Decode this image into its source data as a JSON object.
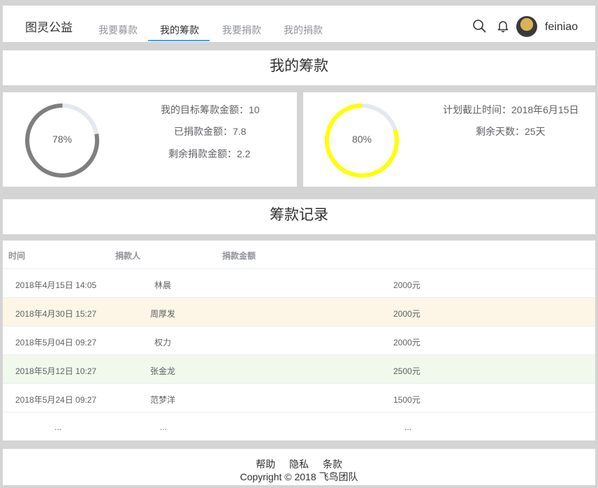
{
  "header": {
    "brand": "图灵公益",
    "tabs": [
      "我要募款",
      "我的筹款",
      "我要捐款",
      "我的捐款"
    ],
    "active_tab": 1,
    "username": "feiniao",
    "icons": [
      "search-icon",
      "bell-icon",
      "avatar"
    ]
  },
  "page_title": "我的筹款",
  "progress_card": {
    "percent_label": "78%",
    "percent_value": 0.78,
    "ring_color": "#7f7f7f",
    "target_line": "我的目标筹款金额：10",
    "raised_line": "已捐款金额：7.8",
    "remaining_line": "剩余捐款金额：2.2"
  },
  "time_card": {
    "percent_label": "80%",
    "percent_value": 0.8,
    "ring_color": "#ffff00",
    "deadline_line": "计划截止时间：2018年6月15日",
    "days_left_line": "剩余天数：25天"
  },
  "records_title": "筹款记录",
  "table": {
    "headers": [
      "时间",
      "捐款人",
      "捐款金额"
    ],
    "rows": [
      {
        "time": "2018年4月15日 14:05",
        "donor": "林晨",
        "amount": "2000元",
        "status": ""
      },
      {
        "time": "2018年4月30日 15:27",
        "donor": "周厚发",
        "amount": "2000元",
        "status": "warn"
      },
      {
        "time": "2018年5月04日 09:27",
        "donor": "权力",
        "amount": "2000元",
        "status": ""
      },
      {
        "time": "2018年5月12日 10:27",
        "donor": "张金龙",
        "amount": "2500元",
        "status": "ok"
      },
      {
        "time": "2018年5月24日 09:27",
        "donor": "范梦洋",
        "amount": "1500元",
        "status": ""
      },
      {
        "time": "...",
        "donor": "...",
        "amount": "...",
        "status": ""
      }
    ]
  },
  "footer": {
    "links": [
      "帮助",
      "隐私",
      "条款"
    ],
    "copyright": "Copyright © 2018 飞鸟团队"
  },
  "colors": {
    "accent": "#409eff",
    "ring_track": "#e4e8f1",
    "row_warning": "#fdf5e6",
    "row_success": "#f0f9eb"
  }
}
